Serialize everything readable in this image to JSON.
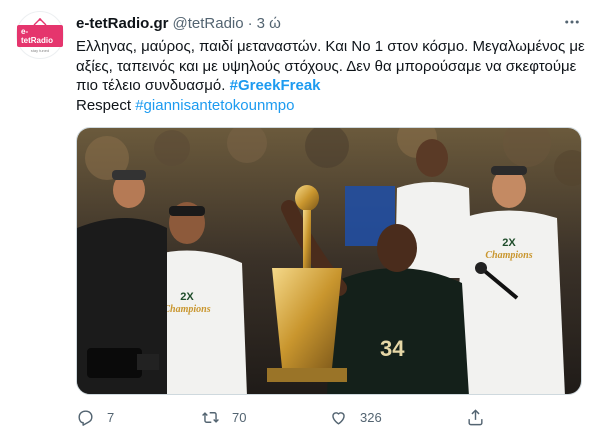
{
  "tweet": {
    "display_name": "e-tetRadio.gr",
    "handle": "@tetRadio",
    "separator": "·",
    "time": "3 ώ",
    "avatar": {
      "logo_text": "e-tetRadio",
      "logo_tagline": "stay tuned"
    },
    "text_line_1": "Ελληνας, μαύρος, παιδί μεταναστών. Και Νο 1 στον κόσμο. Μεγαλωμένος με αξίες, ταπεινός και με υψηλούς στόχους. Δεν θα μπορούσαμε να σκεφτούμε πιο τέλειο συνδυασμό.",
    "hashtag_1": "#GreekFreak",
    "text_line_2": "Respect",
    "hashtag_2": "#giannisantetokounmpo",
    "image": {
      "jersey_number": "34",
      "shirt_text_1": "2X",
      "shirt_text_2": "Champions"
    }
  },
  "actions": {
    "reply_count": "7",
    "retweet_count": "70",
    "like_count": "326"
  },
  "colors": {
    "link": "#1d9bf0",
    "icon": "#536471",
    "brand": "#e5356d"
  }
}
